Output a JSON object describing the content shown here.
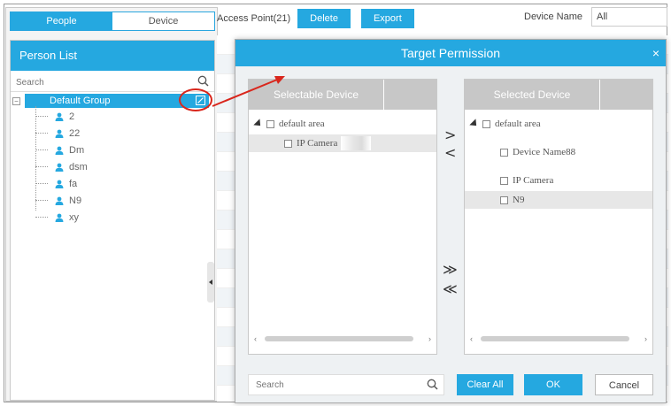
{
  "tabs": [
    {
      "label": "People",
      "active": true
    },
    {
      "label": "Device",
      "active": false
    }
  ],
  "person_list": {
    "title": "Person List",
    "search_placeholder": "Search",
    "group": "Default Group",
    "people": [
      "2",
      "22",
      "Dm",
      "dsm",
      "fa",
      "N9",
      "xy"
    ]
  },
  "toolbar": {
    "access_point_label": "Access Point(21)",
    "delete_label": "Delete",
    "export_label": "Export",
    "device_name_label": "Device Name",
    "device_name_value": "All"
  },
  "dialog": {
    "title": "Target Permission",
    "close_glyph": "×",
    "selectable": {
      "title": "Selectable Device",
      "area": "default area",
      "devices": [
        "IP Camera"
      ]
    },
    "selected": {
      "title": "Selected Device",
      "area": "default area",
      "devices": [
        "Device Name88",
        "IP Camera",
        "N9"
      ]
    },
    "move": {
      "add_one": ">",
      "remove_one": "<",
      "add_all": "≫",
      "remove_all": "≪"
    },
    "search_placeholder": "Search",
    "clear_all_label": "Clear All",
    "ok_label": "OK",
    "cancel_label": "Cancel"
  },
  "colors": {
    "accent": "#25a8e0",
    "annotation": "#d9261c",
    "header_gray": "#c7c7c7"
  }
}
